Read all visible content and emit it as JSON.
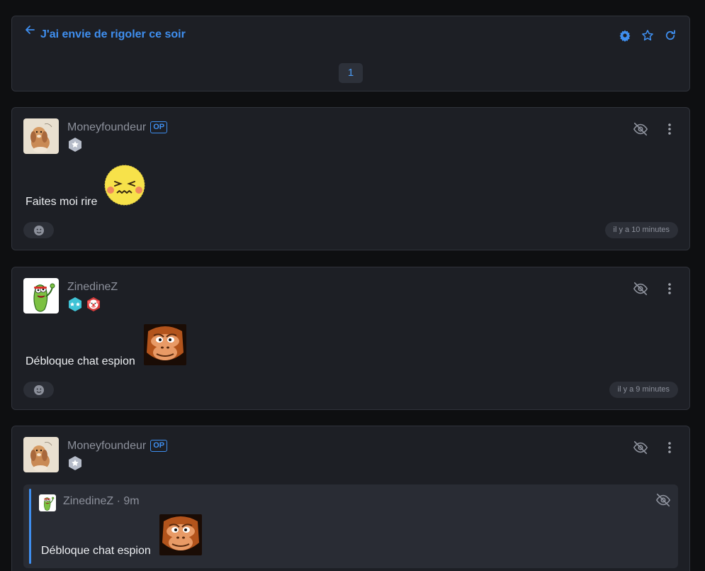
{
  "header": {
    "title": "J'ai envie de rigoler ce soir",
    "page": "1",
    "accent": "#3f8ff0"
  },
  "posts": [
    {
      "username": "Moneyfoundeur",
      "op_label": "OP",
      "text": "Faites moi rire",
      "timestamp": "il y a 10 minutes",
      "emoji": "grimacing-blush-emoji"
    },
    {
      "username": "ZinedineZ",
      "text": "Débloque chat espion",
      "timestamp": "il y a 9 minutes",
      "sticker": "donkey-kong-face"
    },
    {
      "username": "Moneyfoundeur",
      "op_label": "OP",
      "quote": {
        "username": "ZinedineZ",
        "meta": " · 9m",
        "text": "Débloque chat espion"
      }
    }
  ],
  "icons": [
    "back-arrow-icon",
    "gear-icon",
    "star-icon",
    "refresh-icon",
    "eye-off-icon",
    "more-vertical-icon",
    "emoji-icon"
  ]
}
